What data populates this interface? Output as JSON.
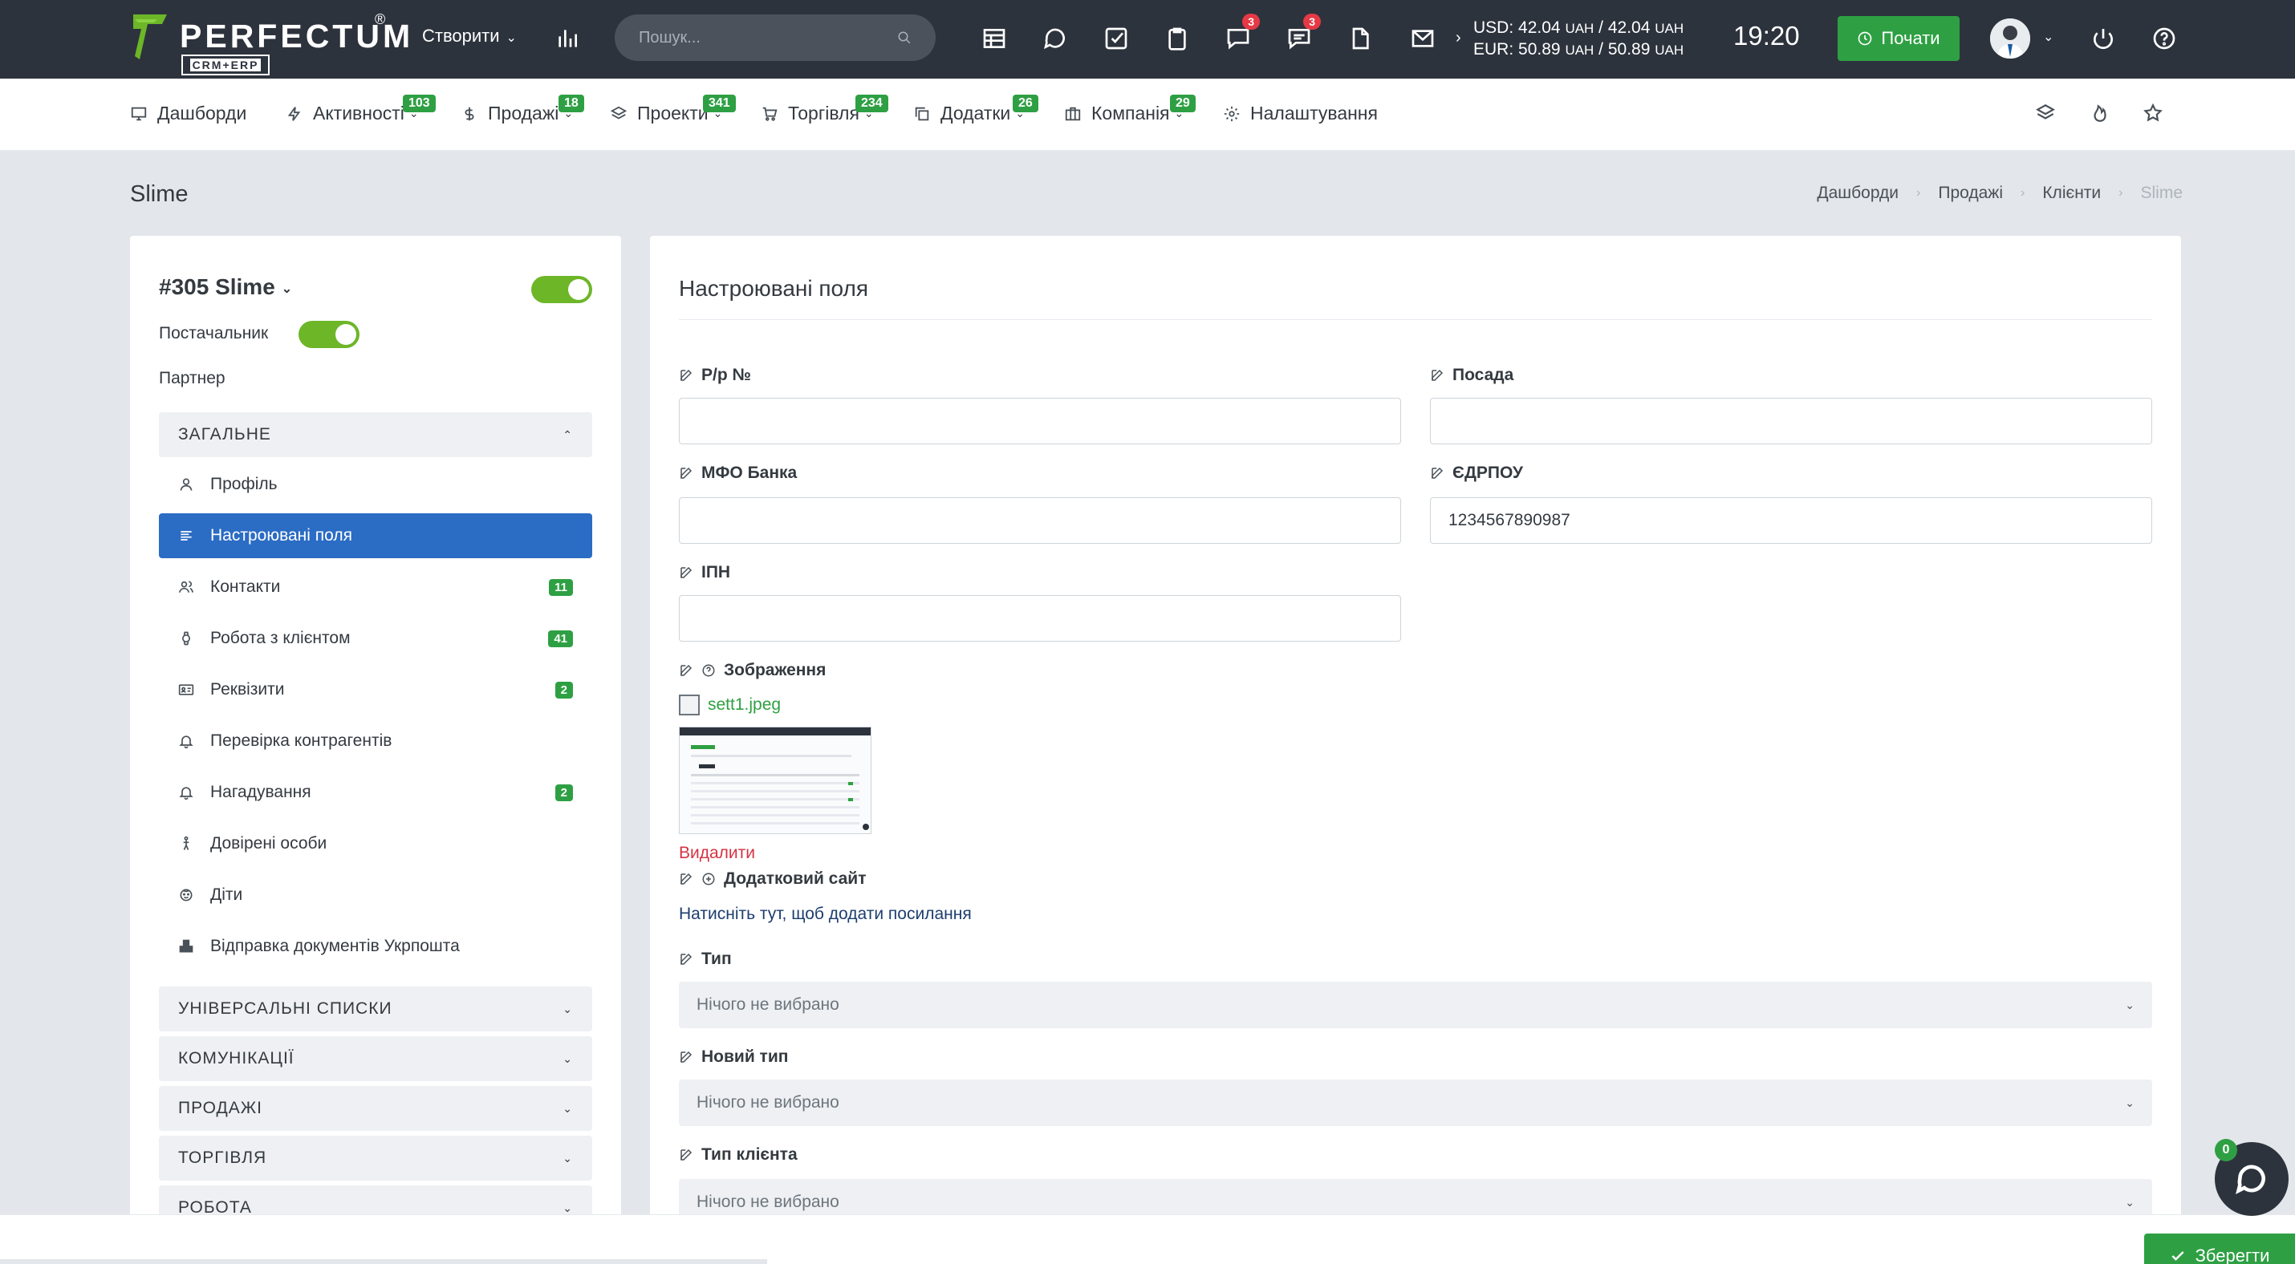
{
  "topbar": {
    "brand": "PERFECTUM",
    "brand_reg": "®",
    "brand_sub": "CRM+ERP",
    "create_label": "Створити",
    "search_placeholder": "Пошук...",
    "badges": {
      "chat": "3",
      "messages": "3"
    },
    "currency": {
      "usd_label": "USD:",
      "usd_value": "42.04",
      "usd_unit1": "UAH",
      "usd_value2": "42.04",
      "usd_unit2": "UAH",
      "eur_label": "EUR:",
      "eur_value": "50.89",
      "eur_unit1": "UAH",
      "eur_value2": "50.89",
      "eur_unit2": "UAH"
    },
    "time": "19:20",
    "start_label": "Почати"
  },
  "nav": {
    "items": [
      {
        "label": "Дашборди",
        "icon": "monitor-icon",
        "badge": ""
      },
      {
        "label": "Активності",
        "icon": "bolt-icon",
        "badge": "103"
      },
      {
        "label": "Продажі",
        "icon": "dollar-icon",
        "badge": "18"
      },
      {
        "label": "Проекти",
        "icon": "layers-icon",
        "badge": "341"
      },
      {
        "label": "Торгівля",
        "icon": "cart-icon",
        "badge": "234"
      },
      {
        "label": "Додатки",
        "icon": "copy-icon",
        "badge": "26"
      },
      {
        "label": "Компанія",
        "icon": "briefcase-icon",
        "badge": "29"
      },
      {
        "label": "Налаштування",
        "icon": "gear-icon",
        "badge": ""
      }
    ]
  },
  "page": {
    "title": "Slime",
    "breadcrumb": [
      "Дашборди",
      "Продажі",
      "Клієнти",
      "Slime"
    ]
  },
  "left": {
    "client_title": "#305 Slime",
    "supplier_label": "Постачальник",
    "partner_label": "Партнер",
    "general_section": "ЗАГАЛЬНЕ",
    "menu": [
      {
        "label": "Профіль",
        "count": ""
      },
      {
        "label": "Настроювані поля",
        "count": ""
      },
      {
        "label": "Контакти",
        "count": "11"
      },
      {
        "label": "Робота з клієнтом",
        "count": "41"
      },
      {
        "label": "Реквізити",
        "count": "2"
      },
      {
        "label": "Перевірка контрагентів",
        "count": ""
      },
      {
        "label": "Нагадування",
        "count": "2"
      },
      {
        "label": "Довірені особи",
        "count": ""
      },
      {
        "label": "Діти",
        "count": ""
      },
      {
        "label": "Відправка документів Укрпошта",
        "count": ""
      }
    ],
    "sections": [
      "УНІВЕРСАЛЬНІ СПИСКИ",
      "КОМУНІКАЦІЇ",
      "ПРОДАЖІ",
      "ТОРГІВЛЯ",
      "РОБОТА"
    ]
  },
  "form": {
    "heading": "Настроювані поля",
    "rp_label": "Р/р №",
    "rp_value": "",
    "position_label": "Посада",
    "position_value": "",
    "mfo_label": "МФО Банка",
    "mfo_value": "",
    "edrpou_label": "ЄДРПОУ",
    "edrpou_value": "1234567890987",
    "ipn_label": "ІПН",
    "ipn_value": "",
    "image_label": "Зображення",
    "image_file": "sett1.jpeg",
    "delete_label": "Видалити",
    "site_label": "Додатковий сайт",
    "site_add": "Натисніть тут, щоб додати посилання",
    "type_label": "Тип",
    "type_value": "Нічого не вибрано",
    "newtype_label": "Новий тип",
    "newtype_value": "Нічого не вибрано",
    "clienttype_label": "Тип клієнта",
    "clienttype_value": "Нічого не вибрано"
  },
  "footer": {
    "save_label": "Зберегти",
    "chat_count": "0"
  },
  "colors": {
    "brand_green": "#2ea043",
    "active_blue": "#2b6cc4",
    "topbar": "#2d333d",
    "toggle_green": "#6cb628",
    "danger": "#d63344"
  }
}
